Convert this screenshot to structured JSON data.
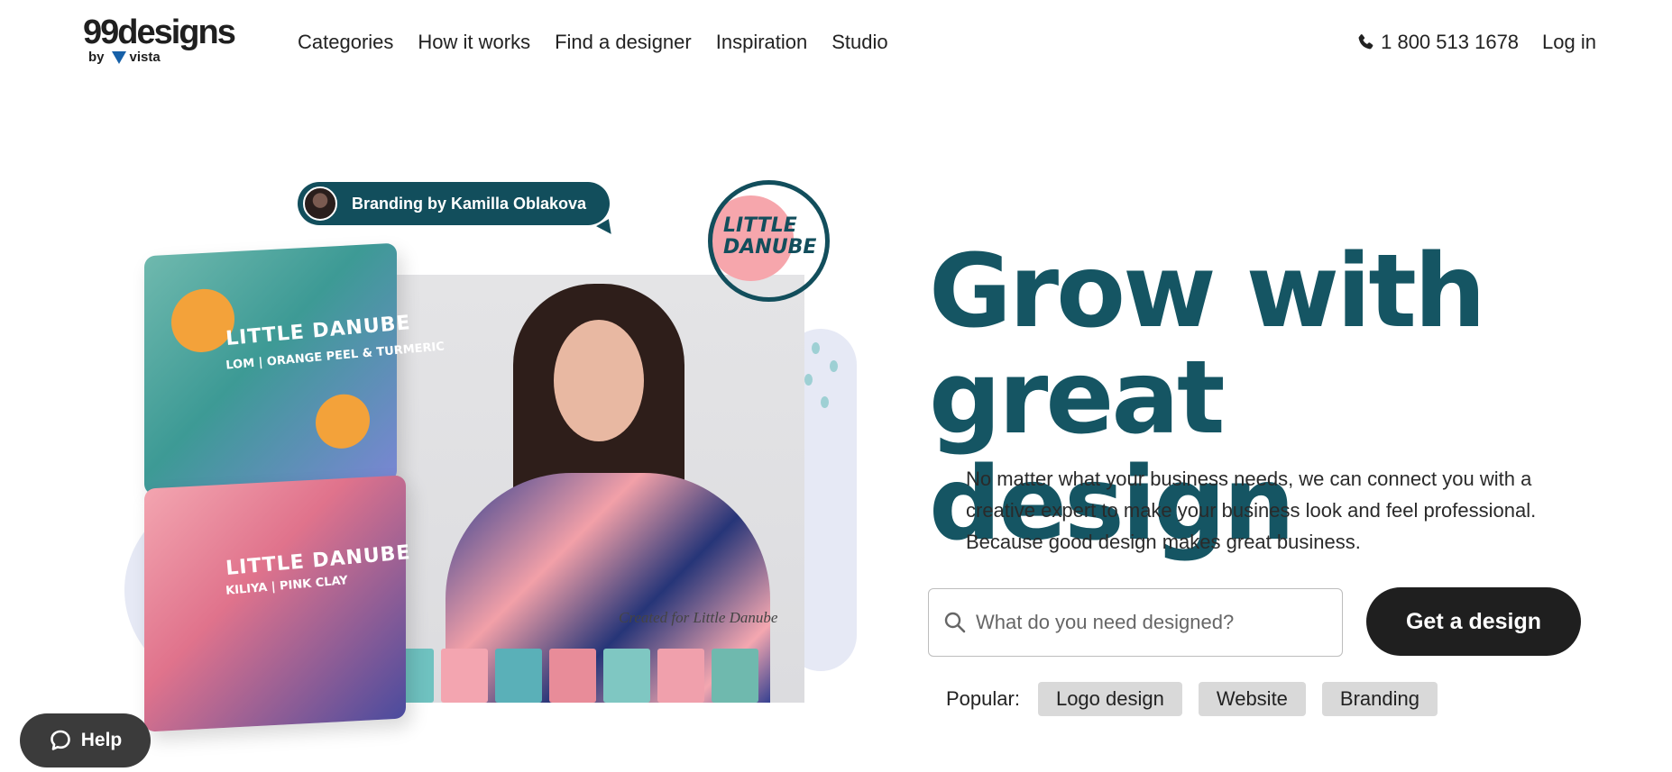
{
  "logo": {
    "wordmark": "99designs",
    "by": "by",
    "partner": "vista"
  },
  "nav": {
    "items": [
      "Categories",
      "How it works",
      "Find a designer",
      "Inspiration",
      "Studio"
    ]
  },
  "header": {
    "phone": "1 800 513 1678",
    "login": "Log in"
  },
  "hero": {
    "credit": "Branding by Kamilla Oblakova",
    "badge_text": "LITTLE DANUBE",
    "box_top_label": "LITTLE DANUBE",
    "box_top_sub": "LOM | ORANGE PEEL & TURMERIC",
    "box_bottom_label": "LITTLE DANUBE",
    "box_bottom_sub": "KILIYA | PINK CLAY",
    "caption": "Created for Little Danube",
    "headline_line1": "Grow with",
    "headline_line2": "great design",
    "subtext": "No matter what your business needs, we can connect you with a creative expert to make your business look and feel professional. Because good design makes great business."
  },
  "search": {
    "placeholder": "What do you need designed?",
    "value": ""
  },
  "cta": {
    "label": "Get a design"
  },
  "popular": {
    "label": "Popular:",
    "chips": [
      "Logo design",
      "Website",
      "Branding"
    ]
  },
  "help": {
    "label": "Help"
  },
  "colors": {
    "brand_teal": "#155563",
    "cta_bg": "#1f1f1f",
    "chip_bg": "#d9d9d9",
    "badge_pink": "#f6a6ac"
  }
}
